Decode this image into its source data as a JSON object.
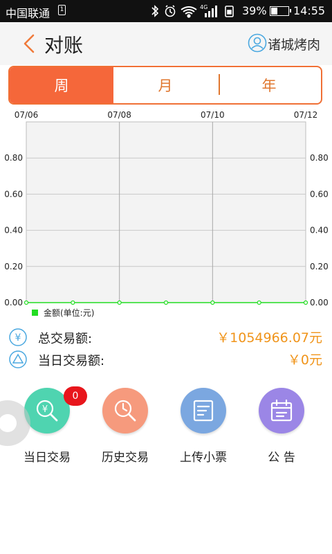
{
  "status_bar": {
    "carrier": "中国联通",
    "sim": "1",
    "network": "4G",
    "battery_pct": "39%",
    "battery_level": 0.39,
    "clock": "14:55"
  },
  "header": {
    "back_icon": "chevron-left-icon",
    "title": "对账",
    "user_icon": "user-circle-icon",
    "user_name": "诸城烤肉"
  },
  "tabs": [
    {
      "label": "周",
      "active": true
    },
    {
      "label": "月",
      "active": false
    },
    {
      "label": "年",
      "active": false
    }
  ],
  "chart_data": {
    "type": "line",
    "x": [
      "07/06",
      "07/07",
      "07/08",
      "07/09",
      "07/10",
      "07/11",
      "07/12"
    ],
    "x_tick_labels": [
      "07/06",
      "07/08",
      "07/10",
      "07/12"
    ],
    "series": [
      {
        "name": "金额(单位:元)",
        "values": [
          0,
          0,
          0,
          0,
          0,
          0,
          0
        ],
        "color": "#22dd22"
      }
    ],
    "y_tick_labels": [
      "0.00",
      "0.20",
      "0.40",
      "0.60",
      "0.80"
    ],
    "ylim": [
      0,
      1
    ],
    "grid": true,
    "legend": "bottom-left",
    "y_axis_both_sides": true
  },
  "summary": {
    "total": {
      "icon": "yen-circle-icon",
      "label": "总交易额:",
      "value": "￥1054966.07元"
    },
    "today": {
      "icon": "triangle-circle-icon",
      "label": "当日交易额:",
      "value": "￥0元"
    }
  },
  "features": [
    {
      "label": "当日交易",
      "icon": "yen-search-icon",
      "color": "#4fd4b0",
      "badge": "0"
    },
    {
      "label": "历史交易",
      "icon": "clock-search-icon",
      "color": "#f69a7d"
    },
    {
      "label": "上传小票",
      "icon": "receipt-icon",
      "color": "#7ba7e0"
    },
    {
      "label": "公  告",
      "icon": "calendar-notice-icon",
      "color": "#9b86e6"
    }
  ],
  "colors": {
    "accent": "#f5673a",
    "amount": "#f0941a",
    "status_bar": "#111111"
  }
}
